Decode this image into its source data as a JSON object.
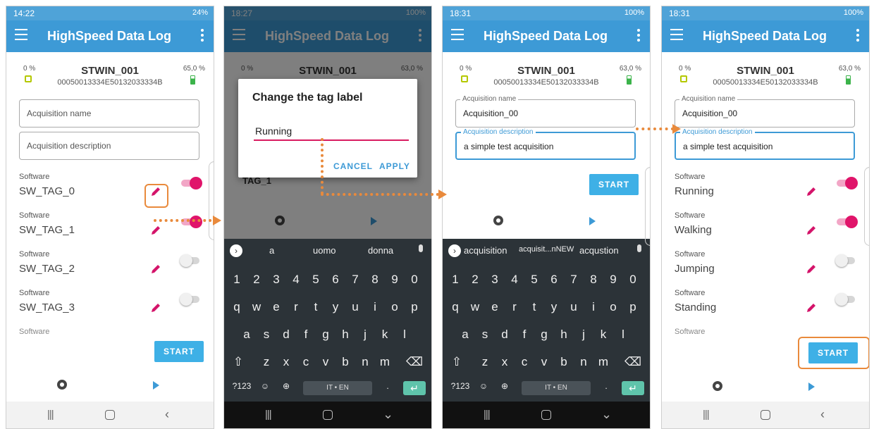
{
  "app": {
    "title": "HighSpeed Data Log"
  },
  "device": {
    "name": "STWIN_001",
    "serial": "00050013334E50132033334B",
    "cpu_load": "0 %"
  },
  "panels": [
    {
      "status_time": "14:22",
      "status_right": "24%",
      "battery": "65,0 %",
      "acq_name_placeholder": "Acquisition name",
      "acq_desc_placeholder": "Acquisition description",
      "tags": [
        {
          "group": "Software",
          "label": "SW_TAG_0",
          "on": true
        },
        {
          "group": "Software",
          "label": "SW_TAG_1",
          "on": true
        },
        {
          "group": "Software",
          "label": "SW_TAG_2",
          "on": false
        },
        {
          "group": "Software",
          "label": "SW_TAG_3",
          "on": false
        }
      ],
      "more_group": "Software",
      "start": "START"
    },
    {
      "status_time": "18:27",
      "status_right": "100%",
      "battery": "63,0 %",
      "dialog": {
        "title": "Change the tag label",
        "value": "Running",
        "cancel": "CANCEL",
        "apply": "APPLY"
      },
      "partial_tag": "TAG_1",
      "keyboard": {
        "suggestions": [
          "a",
          "uomo",
          "donna"
        ],
        "lang": "IT • EN"
      }
    },
    {
      "status_time": "18:31",
      "status_right": "100%",
      "battery": "63,0 %",
      "acq_name_label": "Acquisition name",
      "acq_name_value": "Acquisition_00",
      "acq_desc_label": "Acquisition description",
      "acq_desc_value": "a simple test acquisition",
      "start": "START",
      "keyboard": {
        "suggestions": [
          "acquisition",
          "acquisit...nNEW",
          "acqustion"
        ],
        "lang": "IT • EN"
      }
    },
    {
      "status_time": "18:31",
      "status_right": "100%",
      "battery": "63,0 %",
      "acq_name_label": "Acquisition name",
      "acq_name_value": "Acquisition_00",
      "acq_desc_label": "Acquisition description",
      "acq_desc_value": "a simple test acquisition",
      "tags": [
        {
          "group": "Software",
          "label": "Running",
          "on": true
        },
        {
          "group": "Software",
          "label": "Walking",
          "on": true
        },
        {
          "group": "Software",
          "label": "Jumping",
          "on": false
        },
        {
          "group": "Software",
          "label": "Standing",
          "on": false
        }
      ],
      "more_group": "Software",
      "start": "START"
    }
  ],
  "keys": {
    "numbers": [
      "1",
      "2",
      "3",
      "4",
      "5",
      "6",
      "7",
      "8",
      "9",
      "0"
    ],
    "row1": [
      "q",
      "w",
      "e",
      "r",
      "t",
      "y",
      "u",
      "i",
      "o",
      "p"
    ],
    "row2": [
      "a",
      "s",
      "d",
      "f",
      "g",
      "h",
      "j",
      "k",
      "l"
    ],
    "row3": [
      "z",
      "x",
      "c",
      "v",
      "b",
      "n",
      "m"
    ],
    "sym": "?123"
  },
  "colors": {
    "appbar": "#3d9ad6",
    "accent": "#e0146a",
    "highlight": "#e98a3c",
    "start": "#3eb0e6"
  }
}
